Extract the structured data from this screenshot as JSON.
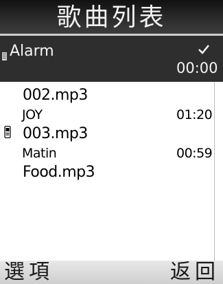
{
  "header": {
    "title": "歌曲列表"
  },
  "selected": {
    "label": "Alarm",
    "checked": true,
    "time": "00:00",
    "icon": "file-icon"
  },
  "songs": [
    {
      "file": "002.mp3",
      "artist": "JOY",
      "duration": "01:20",
      "icon": ""
    },
    {
      "file": "003.mp3",
      "artist": "Matin",
      "duration": "00:59",
      "icon": "phone-icon"
    },
    {
      "file": "Food.mp3",
      "artist": "",
      "duration": "",
      "icon": ""
    }
  ],
  "softkeys": {
    "left": "選項",
    "right": "返回"
  },
  "colors": {
    "title_bg": "#2b2b2b",
    "selected_bg": "#2e2e2e",
    "softkey_bg": "#d9d9d9"
  }
}
